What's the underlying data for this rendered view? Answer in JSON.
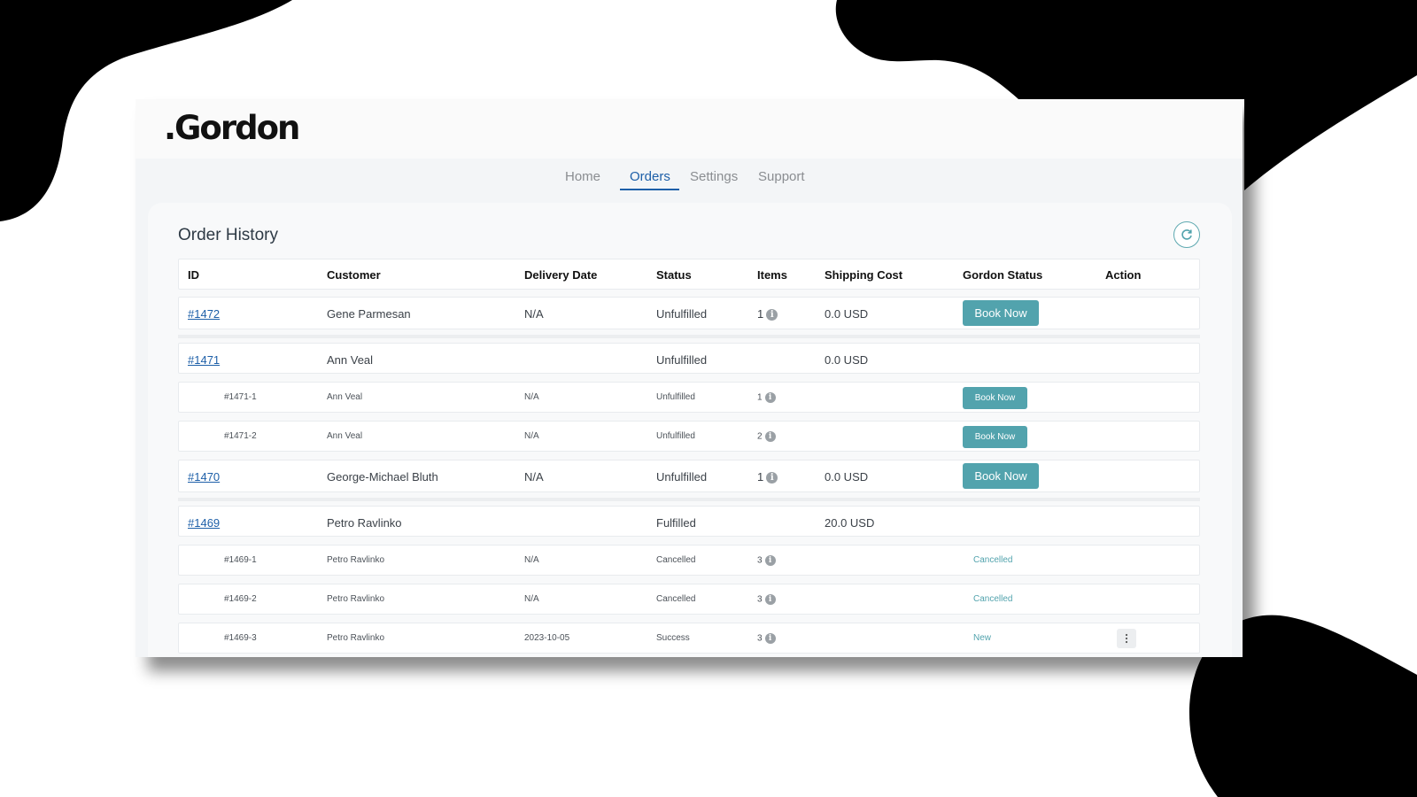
{
  "app": {
    "logo": ".Gordon"
  },
  "nav": {
    "items": [
      {
        "label": "Home"
      },
      {
        "label": "Orders"
      },
      {
        "label": "Settings"
      },
      {
        "label": "Support"
      }
    ],
    "active": "Orders"
  },
  "page": {
    "title": "Order History"
  },
  "table": {
    "headers": [
      "ID",
      "Customer",
      "Delivery Date",
      "Status",
      "Items",
      "Shipping Cost",
      "Gordon Status",
      "Action"
    ],
    "rows": [
      {
        "id": "#1472",
        "customer": "Gene Parmesan",
        "delivery_date": "N/A",
        "status": "Unfulfilled",
        "items": "1",
        "shipping_cost": "0.0 USD",
        "gordon_status": "Book Now"
      },
      {
        "id": "#1471",
        "customer": "Ann Veal",
        "delivery_date": "",
        "status": "Unfulfilled",
        "items": "",
        "shipping_cost": "0.0 USD",
        "gordon_status": ""
      },
      {
        "id": "#1471-1",
        "customer": "Ann Veal",
        "delivery_date": "N/A",
        "status": "Unfulfilled",
        "items": "1",
        "shipping_cost": "",
        "gordon_status": "Book Now"
      },
      {
        "id": "#1471-2",
        "customer": "Ann Veal",
        "delivery_date": "N/A",
        "status": "Unfulfilled",
        "items": "2",
        "shipping_cost": "",
        "gordon_status": "Book Now"
      },
      {
        "id": "#1470",
        "customer": "George-Michael Bluth",
        "delivery_date": "N/A",
        "status": "Unfulfilled",
        "items": "1",
        "shipping_cost": "0.0 USD",
        "gordon_status": "Book Now"
      },
      {
        "id": "#1469",
        "customer": "Petro Ravlinko",
        "delivery_date": "",
        "status": "Fulfilled",
        "items": "",
        "shipping_cost": "20.0 USD",
        "gordon_status": ""
      },
      {
        "id": "#1469-1",
        "customer": "Petro Ravlinko",
        "delivery_date": "N/A",
        "status": "Cancelled",
        "items": "3",
        "shipping_cost": "",
        "gordon_status": "Cancelled"
      },
      {
        "id": "#1469-2",
        "customer": "Petro Ravlinko",
        "delivery_date": "N/A",
        "status": "Cancelled",
        "items": "3",
        "shipping_cost": "",
        "gordon_status": "Cancelled"
      },
      {
        "id": "#1469-3",
        "customer": "Petro Ravlinko",
        "delivery_date": "2023-10-05",
        "status": "Success",
        "items": "3",
        "shipping_cost": "",
        "gordon_status": "New"
      }
    ]
  },
  "colors": {
    "accent_teal": "#52a3ad",
    "link_blue": "#1d5fa8",
    "background_blob": "#000000"
  },
  "icons": {
    "refresh": "refresh-icon",
    "info": "info-icon",
    "more": "kebab-menu-icon"
  }
}
